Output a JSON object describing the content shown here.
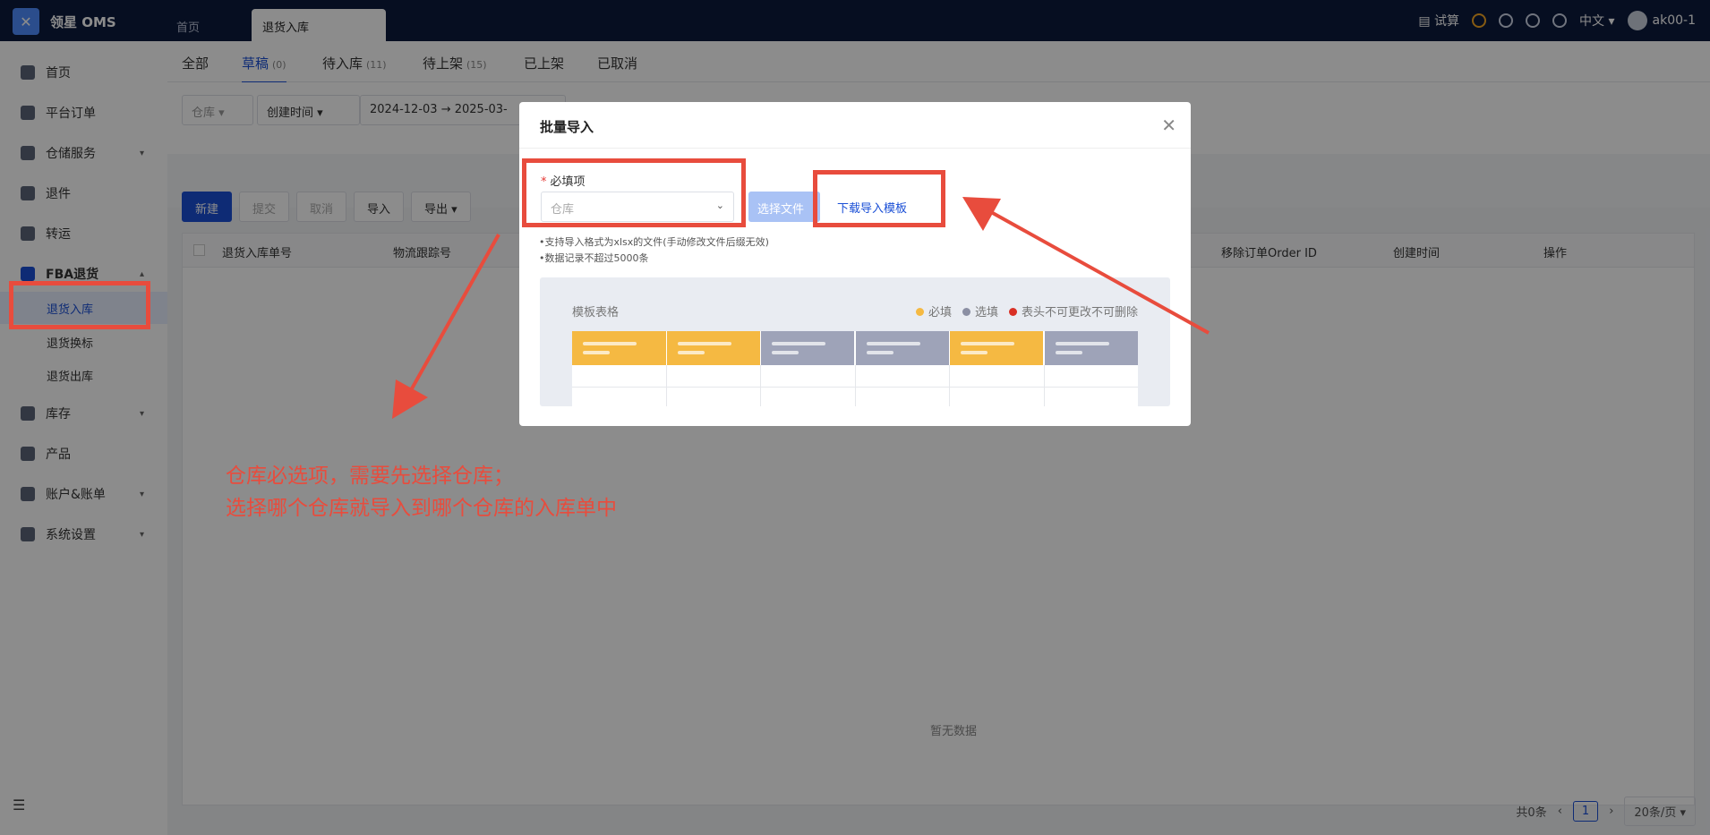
{
  "topbar": {
    "brand": "领星 OMS",
    "tabs": [
      "首页",
      "退货入库"
    ],
    "trial": "试算",
    "lang": "中文",
    "user": "ak00-1"
  },
  "sidebar": {
    "items": [
      {
        "label": "首页",
        "icon": "home-icon"
      },
      {
        "label": "平台订单",
        "icon": "order-icon"
      },
      {
        "label": "仓储服务",
        "icon": "warehouse-icon",
        "has_chevron": true
      },
      {
        "label": "退件",
        "icon": "return-icon"
      },
      {
        "label": "转运",
        "icon": "transfer-icon"
      },
      {
        "label": "FBA退货",
        "icon": "amazon-icon",
        "has_chevron": true
      }
    ],
    "subitems": [
      "退货入库",
      "退货换标",
      "退货出库"
    ],
    "items2": [
      {
        "label": "库存",
        "icon": "inventory-icon",
        "has_chevron": true
      },
      {
        "label": "产品",
        "icon": "product-icon"
      },
      {
        "label": "账户&账单",
        "icon": "account-icon",
        "has_chevron": true
      },
      {
        "label": "系统设置",
        "icon": "settings-icon",
        "has_chevron": true
      }
    ]
  },
  "status_tabs": [
    {
      "label": "全部",
      "count": ""
    },
    {
      "label": "草稿",
      "count": "(0)"
    },
    {
      "label": "待入库",
      "count": "(11)"
    },
    {
      "label": "待上架",
      "count": "(15)"
    },
    {
      "label": "已上架",
      "count": ""
    },
    {
      "label": "已取消",
      "count": ""
    }
  ],
  "filters": {
    "warehouse": "仓库",
    "time_type": "创建时间",
    "date_from": "2024-12-03",
    "date_to": "2025-03-"
  },
  "toolbar": {
    "new": "新建",
    "submit": "提交",
    "cancel": "取消",
    "import": "导入",
    "export": "导出"
  },
  "table": {
    "headers": [
      "退货入库单号",
      "物流跟踪号",
      "移除订单Order ID",
      "创建时间",
      "操作"
    ],
    "empty": "暂无数据"
  },
  "pager": {
    "total": "共0条",
    "page": "1",
    "size": "20条/页"
  },
  "modal": {
    "title": "批量导入",
    "required_label": "必填项",
    "warehouse_placeholder": "仓库",
    "choose_file": "选择文件",
    "download_template": "下载导入模板",
    "notes": [
      "•支持导入格式为xlsx的文件(手动修改文件后缀无效)",
      "•数据记录不超过5000条"
    ],
    "template_title": "模板表格",
    "legend": [
      {
        "label": "必填",
        "color": "#f5b942"
      },
      {
        "label": "选填",
        "color": "#8b8fa3"
      },
      {
        "label": "表头不可更改不可删除",
        "color": "#d93025"
      }
    ]
  },
  "annotation": {
    "line1": "仓库必选项，需要先选择仓库；",
    "line2": "选择哪个仓库就导入到哪个仓库的入库单中",
    "color": "#e84c3d"
  }
}
